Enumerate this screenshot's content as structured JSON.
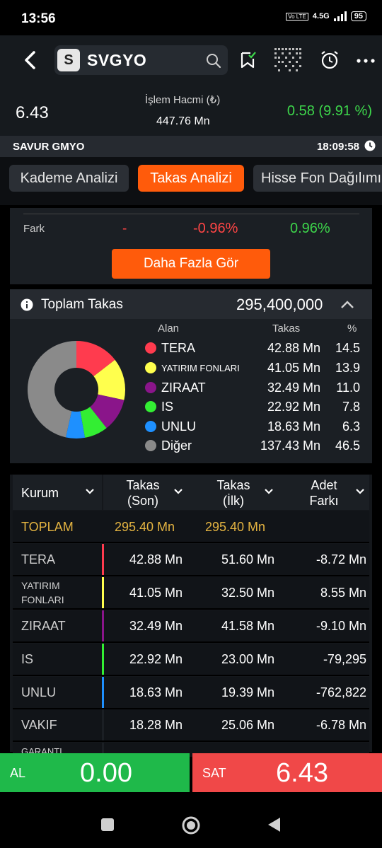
{
  "status_bar": {
    "time": "13:56",
    "network": "4.5G",
    "volte": "Vo LTE",
    "battery": "95"
  },
  "header": {
    "symbol_letter": "S",
    "symbol": "SVGYO"
  },
  "price_bar": {
    "price": "6.43",
    "volume_label": "İşlem Hacmi (₺)",
    "volume_value": "447.76 Mn",
    "change": "0.58 (9.91 %)"
  },
  "info_bar": {
    "company": "SAVUR GMYO",
    "time": "18:09:58"
  },
  "tabs": [
    {
      "label": "Kademe Analizi",
      "active": false
    },
    {
      "label": "Takas Analizi",
      "active": true
    },
    {
      "label": "Hisse Fon Dağılımı",
      "active": false
    }
  ],
  "fark_row": {
    "label": "Fark",
    "col1": "-",
    "col2": "-0.96%",
    "col3": "0.96%"
  },
  "more_button": "Daha Fazla Gör",
  "total": {
    "label": "Toplam Takas",
    "value": "295,400,000"
  },
  "legend": {
    "headers": {
      "name": "Alan",
      "value": "Takas",
      "pct": "%"
    },
    "items": [
      {
        "name": "TERA",
        "value": "42.88 Mn",
        "pct": "14.5",
        "color": "#ff3b4e"
      },
      {
        "name": "YATIRIM FONLARI",
        "value": "41.05 Mn",
        "pct": "13.9",
        "color": "#ffff4d"
      },
      {
        "name": "ZIRAAT",
        "value": "32.49 Mn",
        "pct": "11.0",
        "color": "#8a158a"
      },
      {
        "name": "IS",
        "value": "22.92 Mn",
        "pct": "7.8",
        "color": "#33ee33"
      },
      {
        "name": "UNLU",
        "value": "18.63 Mn",
        "pct": "6.3",
        "color": "#1e90ff"
      },
      {
        "name": "Diğer",
        "value": "137.43 Mn",
        "pct": "46.5",
        "color": "#8a8a8a"
      }
    ]
  },
  "table": {
    "headers": {
      "kurum": "Kurum",
      "son_1": "Takas",
      "son_2": "(Son)",
      "ilk_1": "Takas",
      "ilk_2": "(İlk)",
      "fark_1": "Adet",
      "fark_2": "Farkı"
    },
    "total_row": {
      "name": "TOPLAM",
      "son": "295.40 Mn",
      "ilk": "295.40 Mn"
    },
    "rows": [
      {
        "name": "TERA",
        "son": "42.88 Mn",
        "ilk": "51.60 Mn",
        "fark": "-8.72 Mn",
        "color": "#ff3b4e"
      },
      {
        "name_1": "YATIRIM",
        "name_2": "FONLARI",
        "son": "41.05 Mn",
        "ilk": "32.50 Mn",
        "fark": "8.55 Mn",
        "color": "#ffff4d"
      },
      {
        "name": "ZIRAAT",
        "son": "32.49 Mn",
        "ilk": "41.58 Mn",
        "fark": "-9.10 Mn",
        "color": "#8a158a"
      },
      {
        "name": "IS",
        "son": "22.92 Mn",
        "ilk": "23.00 Mn",
        "fark": "-79,295",
        "color": "#33ee33"
      },
      {
        "name": "UNLU",
        "son": "18.63 Mn",
        "ilk": "19.39 Mn",
        "fark": "-762,822",
        "color": "#1e90ff"
      },
      {
        "name": "VAKIF",
        "son": "18.28 Mn",
        "ilk": "25.06 Mn",
        "fark": "-6.78 Mn",
        "color": "#1b1f24"
      }
    ],
    "partial_row": "GARANTI"
  },
  "order_bar": {
    "buy_label": "AL",
    "buy_value": "0.00",
    "sell_label": "SAT",
    "sell_value": "6.43"
  },
  "colors": {
    "accent": "#ff5b0b",
    "up": "#3dd64b",
    "down": "#ff4545",
    "gold": "#e3b341"
  }
}
